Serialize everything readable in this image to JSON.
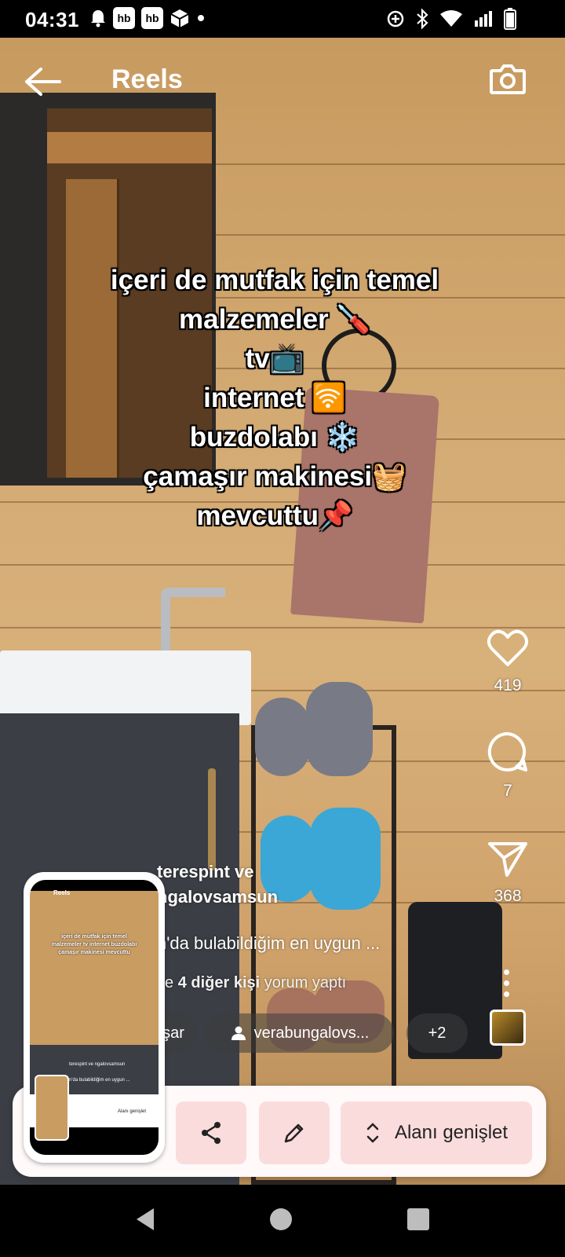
{
  "status_bar": {
    "time": "04:31",
    "badge_1": "hb",
    "badge_2": "hb",
    "icons": [
      "notification-bell-icon",
      "box-icon",
      "data-saver-icon",
      "bluetooth-icon",
      "wifi-icon",
      "signal-icon",
      "battery-icon"
    ]
  },
  "header": {
    "title": "Reels"
  },
  "caption_lines": [
    "içeri de mutfak için temel",
    "malzemeler 🪛",
    "tv📺",
    "internet 🛜",
    "buzdolabı ❄️",
    "çamaşır makinesi🧺",
    "mevcuttu📌"
  ],
  "actions": {
    "likes": "419",
    "comments": "7",
    "shares": "368"
  },
  "post": {
    "author_line_1": "terespint ve",
    "author_line_2": "ngalovsamsun",
    "description": "n'da bulabildiğim en uygun ...",
    "comments_prefix": "ve",
    "comments_bold": "4 diğer kişi",
    "comments_suffix": "yorum yaptı",
    "chip_share": "şar",
    "chip_user": "verabungalovs...",
    "chip_more": "+2"
  },
  "toolbar": {
    "expand_label": "Alanı genişlet"
  },
  "thumbnail": {
    "title": "Reels",
    "caption": "içeri de mutfak için temel malzemeler tv internet buzdolabı çamaşır makinesi mevcuttu",
    "author": "terespint ve ngalovsamsun",
    "desc": "n'da bulabildiğim en uygun ...",
    "expand": "Alanı genişlet"
  },
  "colors": {
    "toolbar_bg": "#fff9f9",
    "button_bg": "#fadcdc",
    "wood": "#d4ab74"
  }
}
